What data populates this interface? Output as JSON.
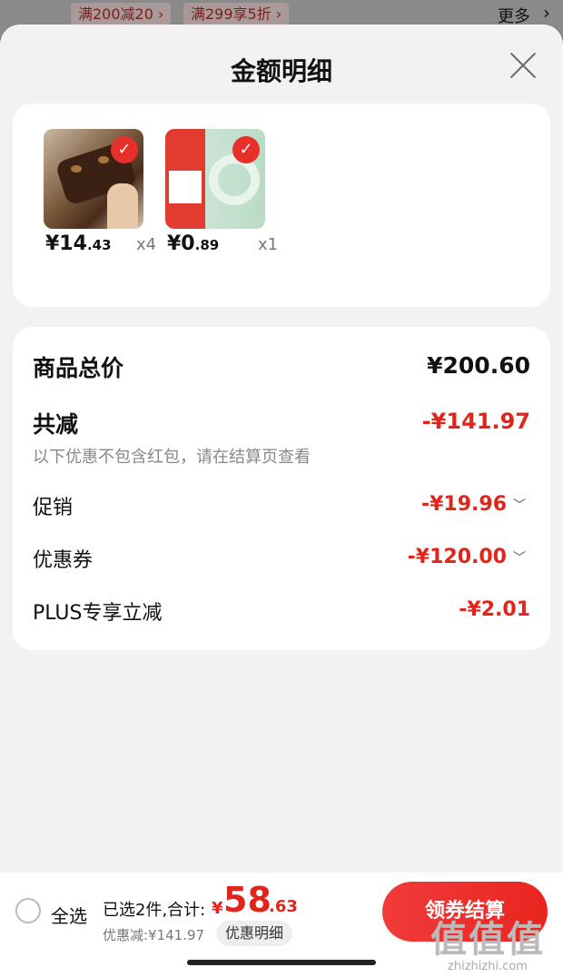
{
  "background": {
    "promo_tags": [
      "满200减20 ›",
      "满299享5折 ›"
    ],
    "more_label": "更多",
    "more_chevron": "›"
  },
  "sheet": {
    "title": "金额明细",
    "close_icon": "close-icon"
  },
  "products": [
    {
      "name": "ice-cream",
      "price_int": "¥14",
      "price_cents": ".43",
      "qty": "x4",
      "selected": true
    },
    {
      "name": "tape",
      "price_int": "¥0",
      "price_cents": ".89",
      "qty": "x1",
      "selected": true
    }
  ],
  "summary": {
    "total_label": "商品总价",
    "total_value": "¥200.60",
    "reduce_label": "共减",
    "reduce_value": "-¥141.97",
    "note": "以下优惠不包含红包，请在结算页查看",
    "rows": [
      {
        "label": "促销",
        "value": "-¥19.96",
        "chevron": "﹀"
      },
      {
        "label": "优惠券",
        "value": "-¥120.00",
        "chevron": "﹀"
      },
      {
        "label": "PLUS专享立减",
        "value": "-¥2.01"
      }
    ]
  },
  "bottom_bar": {
    "select_all": "全选",
    "selected_text": "已选2件,合计:",
    "total_yen": "¥",
    "total_int": "58",
    "total_dec": ".63",
    "discount_text": "优惠减:¥141.97",
    "detail_pill": "优惠明细",
    "checkout_label": "领券结算"
  },
  "watermark": {
    "big": "值值值",
    "small": "zhizhizhi.com"
  },
  "colors": {
    "accent_red": "#e1251b",
    "sheet_bg": "#f2f2f2",
    "card_bg": "#ffffff"
  }
}
